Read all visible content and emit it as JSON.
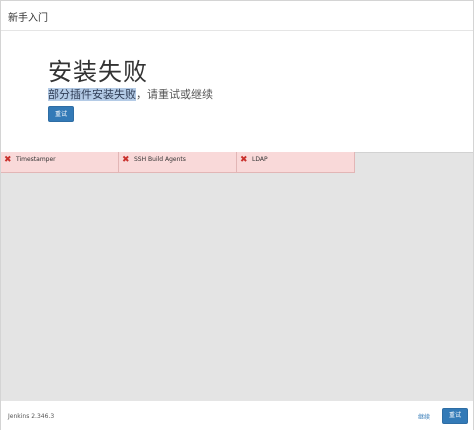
{
  "header": {
    "title": "新手入门"
  },
  "hero": {
    "heading": "安装失败",
    "subtitle_highlight": "部分插件安装失败",
    "subtitle_rest": "，请重试或继续",
    "retry_label": "重试"
  },
  "plugins": [
    {
      "name": "Timestamper",
      "status_icon": "close-icon"
    },
    {
      "name": "SSH Build Agents",
      "status_icon": "close-icon"
    },
    {
      "name": "LDAP",
      "status_icon": "close-icon"
    }
  ],
  "footer": {
    "version": "Jenkins 2.346.3",
    "continue_label": "继续",
    "retry_label": "重试"
  },
  "colors": {
    "primary": "#337ab7",
    "failed_bg": "#f9d9d9",
    "failed_icon": "#c9302c"
  }
}
